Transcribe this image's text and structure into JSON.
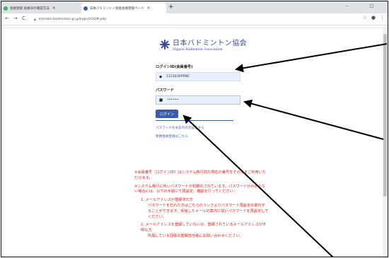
{
  "browser": {
    "tabs": [
      {
        "label": "会員登録 会員IDの確認方法"
      },
      {
        "label": "日本バドミントン協会会員登録ページ"
      }
    ],
    "new_tab": "+",
    "url": "member.badminton-jp.jp/login/LOGIN.php",
    "window_controls": "–  □",
    "tools": "☆  ⋮"
  },
  "logo": {
    "ja": "日本バドミントン協会",
    "en": "Nippon Badminton Association"
  },
  "form": {
    "id_label": "ログインID(会員番号)",
    "id_value": "1221836PRNC",
    "password_label": "パスワード",
    "password_value": "••••••",
    "login_button": "ログイン",
    "forgot_link": "パスワードをお忘れの方はこちら",
    "register_link": "新規会員登録はこちら"
  },
  "notes": {
    "p1": "※会員番号（ログインID）はシステム移行前の現在の番号をそのままご利用いただけます。",
    "p2": "※システム移行に伴いパスワードが初期化されています。パスワードがわからない場合には、以下の手順にて再設定、確認を行ってください。",
    "item1_title": "1. メールアドレスが登録済の方",
    "item1_body": "パスワードを忘れた方はこちらのリンクよりパスワード再設定の案内することができます。受信したメールの案内に従いパスワードを再設定してください。",
    "item2_title": "2. メールアドレスを登録していないか、登録されているメールアドレスが不明な方",
    "item2_body": "所属している団体の登録担当者にお問い合わせください。"
  }
}
